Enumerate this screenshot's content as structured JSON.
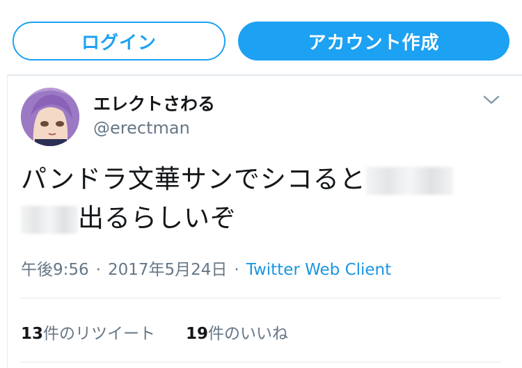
{
  "header": {
    "login_label": "ログイン",
    "signup_label": "アカウント作成"
  },
  "tweet": {
    "display_name": "エレクトさわる",
    "handle": "@erectman",
    "text_line1": "パンドラ文華サンでシコると",
    "text_line2": "出るらしいぞ",
    "time": "午後9:56",
    "date": "2017年5月24日",
    "separator": "·",
    "client": "Twitter Web Client",
    "retweet_count": "13",
    "retweet_label": "件のリツイート",
    "like_count": "19",
    "like_label": "件のいいね"
  },
  "icons": {
    "avatar": "avatar-anime-character",
    "more": "chevron-down-icon"
  },
  "colors": {
    "accent": "#1da1f2",
    "link": "#1b95e0",
    "muted": "#657786",
    "text": "#14171a"
  }
}
